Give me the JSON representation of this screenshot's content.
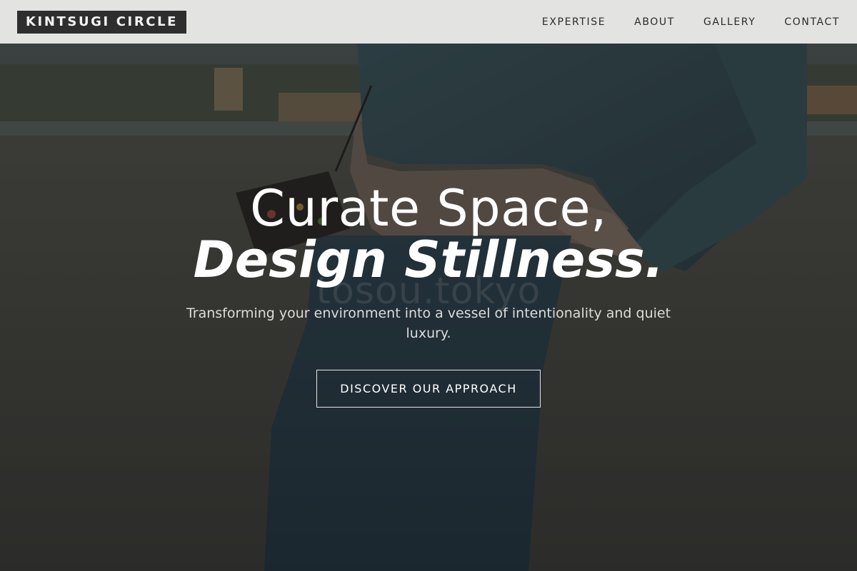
{
  "brand": {
    "name": "KINTSUGI CIRCLE"
  },
  "nav": {
    "items": [
      {
        "label": "EXPERTISE"
      },
      {
        "label": "ABOUT"
      },
      {
        "label": "GALLERY"
      },
      {
        "label": "CONTACT"
      }
    ]
  },
  "hero": {
    "headline_line1": "Curate Space,",
    "headline_line2": "Design Stillness.",
    "subtitle": "Transforming your environment into a vessel of intentionality and quiet luxury.",
    "cta_label": "DISCOVER OUR APPROACH",
    "watermark": "tosou.tokyo"
  },
  "colors": {
    "header_bg": "#ecece a",
    "logo_bg": "#2e2e2e",
    "overlay": "#0f1212"
  }
}
